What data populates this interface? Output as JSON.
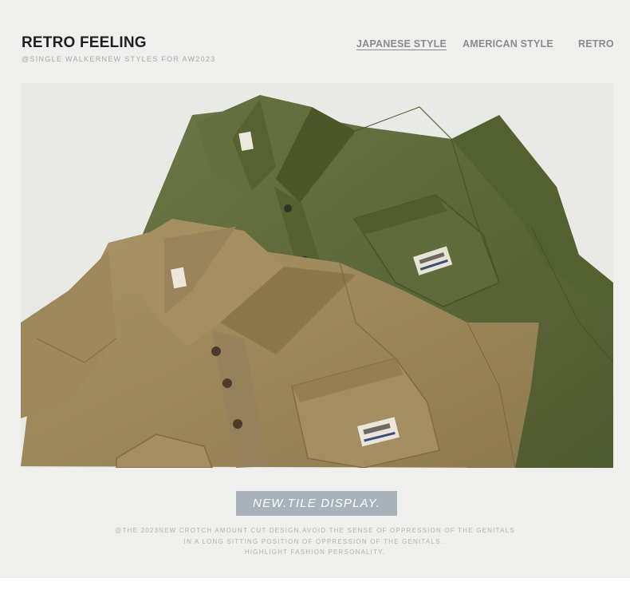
{
  "header": {
    "title": "RETRO FEELING",
    "subtitle": "@SINGLE WALKERNEW STYLES FOR AW2023"
  },
  "nav": {
    "items": [
      {
        "label": "JAPANESE STYLE",
        "active": true
      },
      {
        "label": "AMERICAN STYLE",
        "active": false
      },
      {
        "label": "RETRO",
        "active": false
      }
    ]
  },
  "hero": {
    "description": "Two folded short-sleeve work shirts, khaki in front and olive green behind",
    "colors": {
      "khaki": "#a08a5e",
      "olive": "#5b6638",
      "background": "#e9e9e6"
    }
  },
  "banner": {
    "label": "NEW.TILE DISPLAY."
  },
  "description": {
    "lines": [
      "@THE 2023NEW CROTCH AMOUNT CUT DESIGN,AVOID THE SENSE OF OPPRESSION OF THE GENITALS",
      "IN A LONG SITTING POSITION OF OPPRESSION OF THE GENITALS .",
      "HIGHLIGHT FASHION PERSONALITY."
    ]
  },
  "theme": {
    "page_bg": "#eff0ee",
    "banner_bg": "#a7b2ba",
    "title_color": "#1f1f1f"
  }
}
